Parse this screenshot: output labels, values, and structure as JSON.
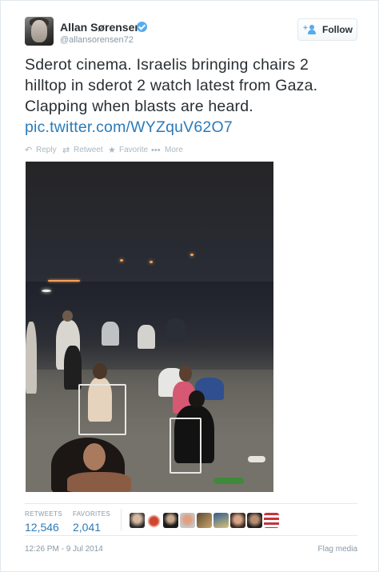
{
  "author": {
    "name": "Allan Sørensen",
    "handle": "@allansorensen72",
    "verified": true
  },
  "follow_button": {
    "label": "Follow",
    "icon": "follow-user-icon"
  },
  "tweet": {
    "lines": [
      "Sderot cinema. Israelis bringing chairs 2",
      "hilltop in sderot 2 watch latest from Gaza.",
      "Clapping when blasts are heard."
    ],
    "link": "pic.twitter.com/WYZquV62O7"
  },
  "actions": [
    {
      "label": "Reply",
      "icon": "reply-icon"
    },
    {
      "label": "Retweet",
      "icon": "retweet-icon"
    },
    {
      "label": "Favorite",
      "icon": "star-icon"
    },
    {
      "label": "More",
      "icon": "more-dots-icon"
    }
  ],
  "stats": {
    "retweets_label": "RETWEETS",
    "retweets_value": "12,546",
    "favorites_label": "FAVORITES",
    "favorites_value": "2,041"
  },
  "favoriter_avatars": [
    "avatar-1",
    "avatar-2",
    "avatar-3",
    "avatar-4",
    "avatar-5",
    "avatar-6",
    "avatar-7",
    "avatar-8",
    "avatar-9"
  ],
  "footer": {
    "timestamp": "12:26 PM - 9 Jul 2014",
    "flag_label": "Flag media"
  },
  "colors": {
    "link": "#2b7bb9",
    "verified": "#55acee",
    "muted": "#8899a6",
    "text": "#292f33"
  }
}
